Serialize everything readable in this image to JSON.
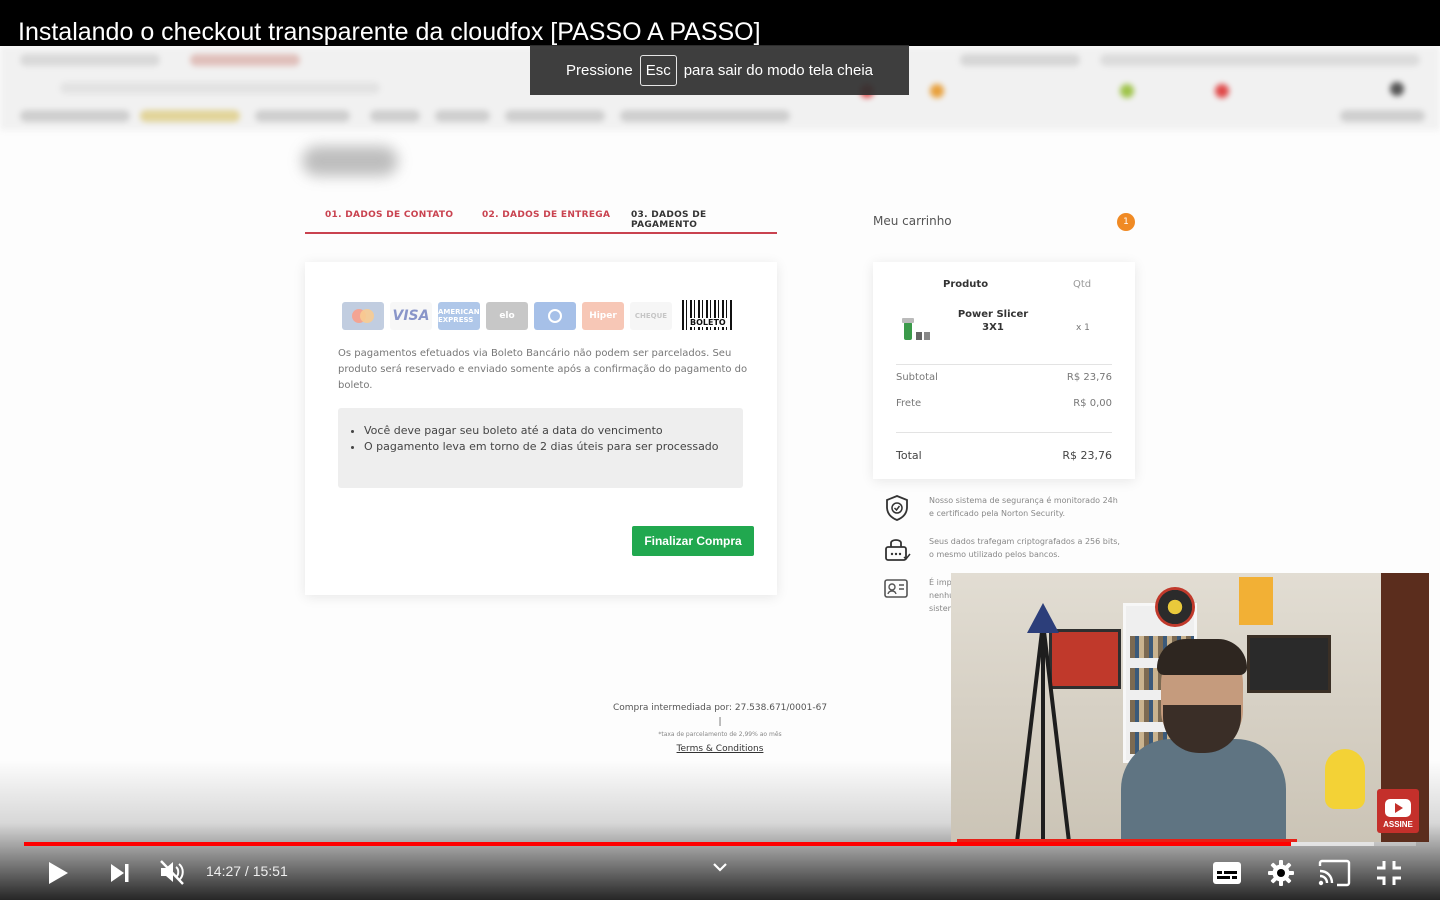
{
  "video": {
    "title": "Instalando o checkout transparente da cloudfox [PASSO A PASSO]",
    "fullscreen_toast": {
      "before": "Pressione",
      "key": "Esc",
      "after": "para sair do modo tela cheia"
    }
  },
  "checkout": {
    "steps": [
      {
        "label": "01. DADOS DE CONTATO"
      },
      {
        "label": "02. DADOS DE ENTREGA"
      },
      {
        "label": "03. DADOS DE PAGAMENTO"
      }
    ],
    "payment_icons": [
      "mastercard-icon",
      "visa-icon",
      "amex-icon",
      "elo-icon",
      "diners-icon",
      "hipercard-icon",
      "cielo-icon",
      "boleto-icon"
    ],
    "payment_labels": {
      "visa": "VISA",
      "amex": "AMERICAN EXPRESS",
      "elo": "elo",
      "hiper": "Hiper",
      "cielo": "CHEQUE",
      "boleto": "BOLETO"
    },
    "note": "Os pagamentos efetuados via Boleto Bancário não podem ser parcelados. Seu produto será reservado e enviado somente após a confirmação do pagamento do boleto.",
    "info_items": [
      "Você deve pagar seu boleto até a data do vencimento",
      "O pagamento leva em torno de 2 dias úteis para ser processado"
    ],
    "finalize_button": "Finalizar Compra"
  },
  "cart": {
    "title": "Meu carrinho",
    "count": "1",
    "col_product": "Produto",
    "col_qty": "Qtd",
    "product_name": "Power Slicer 3X1",
    "product_qty": "x 1",
    "subtotal_label": "Subtotal",
    "subtotal_value": "R$ 23,76",
    "frete_label": "Frete",
    "frete_value": "R$ 0,00",
    "total_label": "Total",
    "total_value": "R$ 23,76"
  },
  "security": [
    {
      "icon": "shield-check-icon",
      "text": "Nosso sistema de segurança é monitorado 24h e certificado pela Norton Security."
    },
    {
      "icon": "lock-icon",
      "text": "Seus dados trafegam criptografados a 256 bits, o mesmo utilizado pelos bancos."
    },
    {
      "icon": "id-card-icon",
      "text": "É impo\nnenhu\nsistem"
    }
  ],
  "footer": {
    "intermediated": "Compra intermediada por: 27.538.671/0001-67",
    "separator": "|",
    "fee_note": "*taxa de parcelamento de 2,99% ao mês",
    "terms": "Terms & Conditions"
  },
  "webcam": {
    "subscribe_label": "ASSINE"
  },
  "player": {
    "current_time": "14:27",
    "duration": "15:51",
    "time_text": "14:27 / 15:51",
    "progress_played": 0.91,
    "progress_buffered": 0.97,
    "accent": "#ff0000"
  }
}
